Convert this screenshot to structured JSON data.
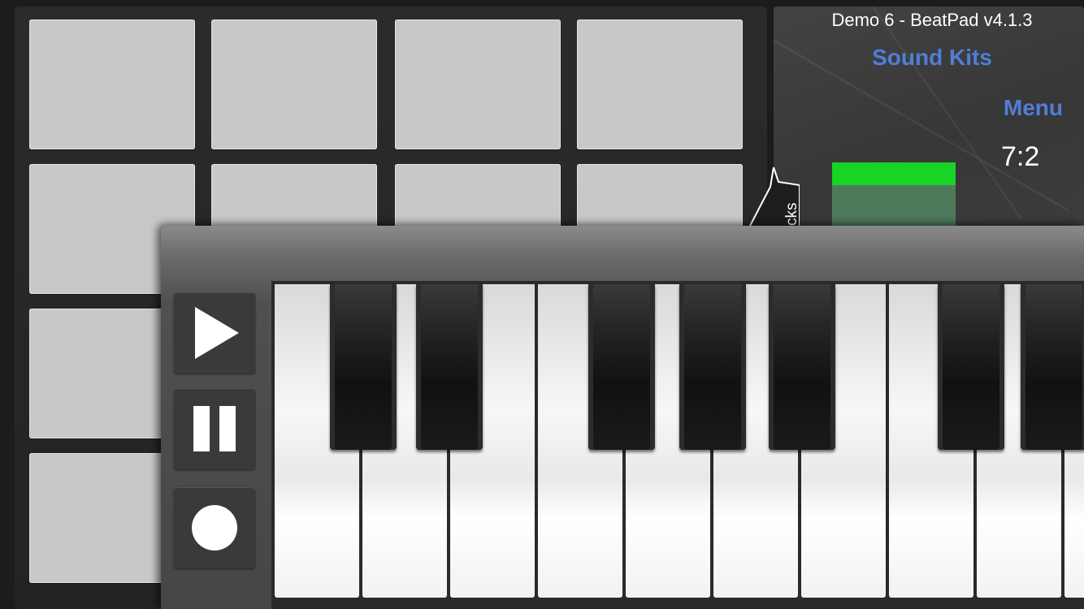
{
  "app_title": "Demo 6 - BeatPad v4.1.3",
  "sound_kits_label": "Sound Kits",
  "menu_label": "Menu",
  "counter": "7:2",
  "tracks_tab_label": "Tracks",
  "tracks_tab_visible_text": "cks",
  "level_meter_fraction": 0.32,
  "colors": {
    "accent_link": "#4f7fd6",
    "level_green": "#19d424",
    "pad": "#c8c8c8"
  },
  "transport": {
    "play_icon": "play-icon",
    "pause_icon": "pause-icon",
    "record_icon": "record-icon"
  }
}
